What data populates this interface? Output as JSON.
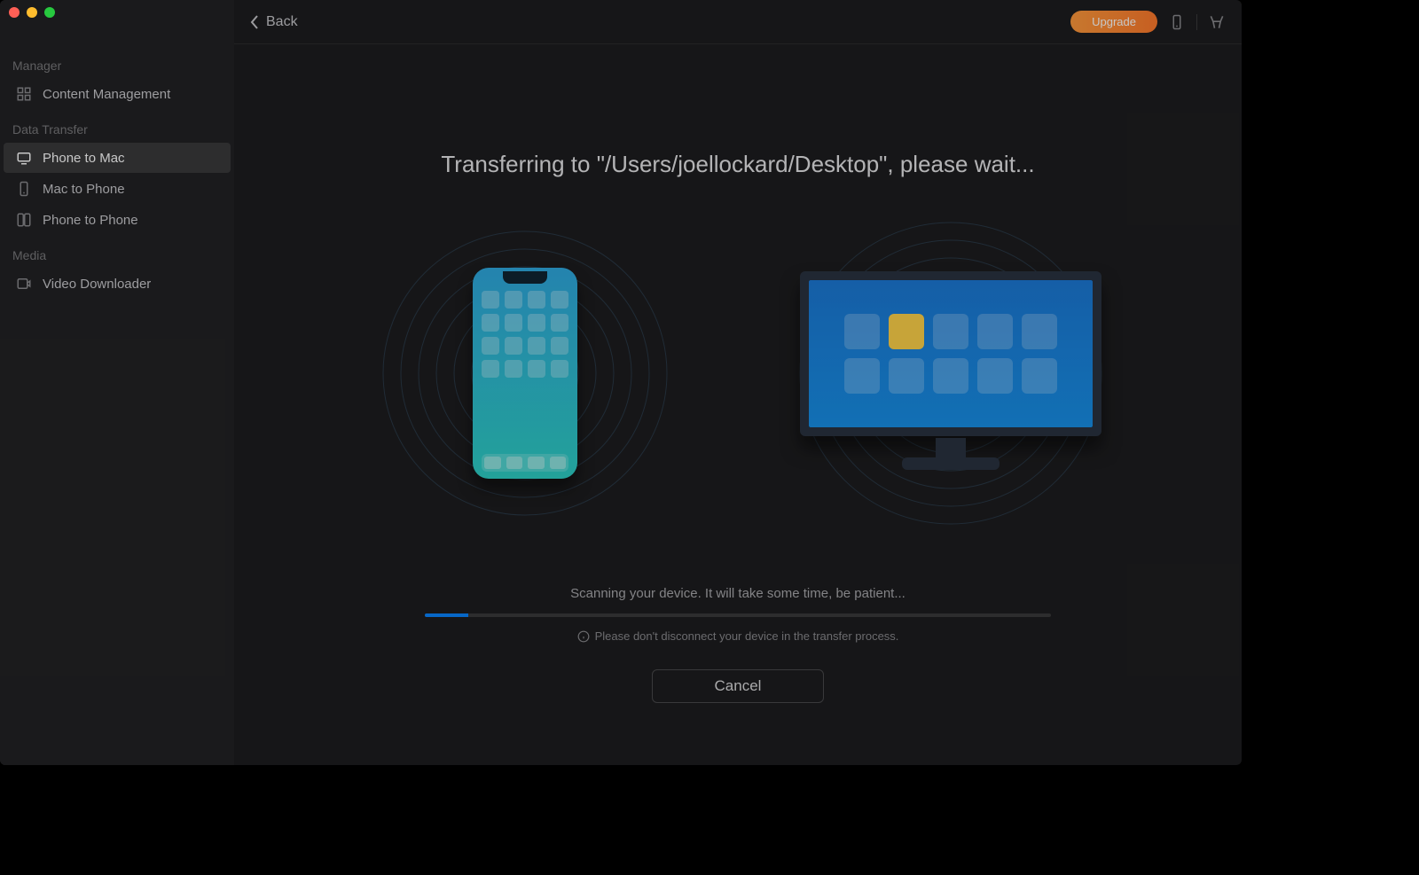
{
  "header": {
    "back_label": "Back",
    "upgrade_label": "Upgrade"
  },
  "sidebar": {
    "groups": [
      {
        "title": "Manager",
        "items": [
          {
            "label": "Content Management",
            "icon": "grid-icon"
          }
        ]
      },
      {
        "title": "Data Transfer",
        "items": [
          {
            "label": "Phone to Mac",
            "icon": "phone-to-mac-icon",
            "active": true
          },
          {
            "label": "Mac to Phone",
            "icon": "mac-to-phone-icon"
          },
          {
            "label": "Phone to Phone",
            "icon": "phone-to-phone-icon"
          }
        ]
      },
      {
        "title": "Media",
        "items": [
          {
            "label": "Video Downloader",
            "icon": "video-download-icon"
          }
        ]
      }
    ]
  },
  "transfer": {
    "headline": "Transferring to \"/Users/joellockard/Desktop\", please wait...",
    "status": "Scanning your device. It will take some time, be patient...",
    "warning": "Please don't disconnect your device in the transfer process.",
    "cancel_label": "Cancel",
    "progress_percent": 7
  }
}
